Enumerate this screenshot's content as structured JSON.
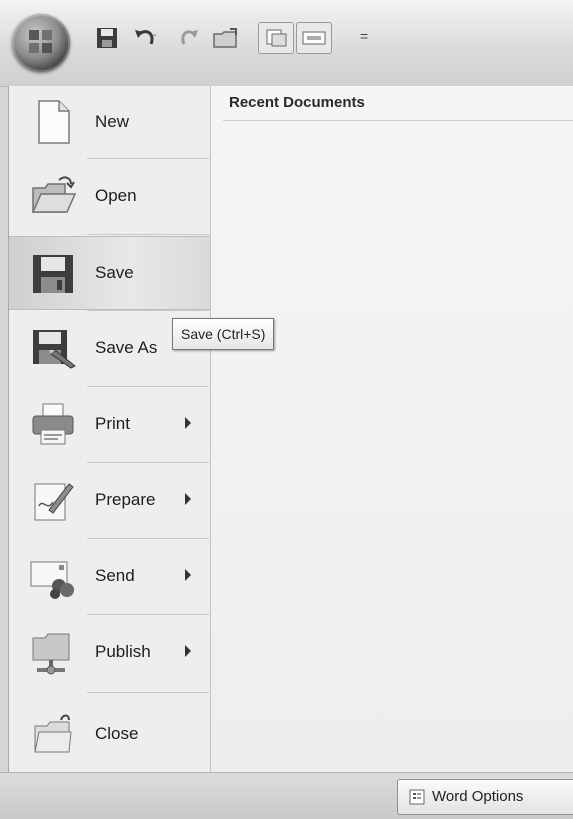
{
  "quick_access_toolbar": {
    "icons": [
      "office-button-icon",
      "save-icon",
      "undo-icon",
      "redo-icon",
      "folder-icon",
      "pages-icon",
      "envelope-icon",
      "customize-icon"
    ],
    "customize_glyph": "="
  },
  "menu": {
    "items": [
      {
        "label": "New",
        "icon": "new-document-icon"
      },
      {
        "label": "Open",
        "icon": "open-folder-icon"
      },
      {
        "label": "Save",
        "icon": "save-icon",
        "selected": true
      },
      {
        "label": "Save As",
        "icon": "save-as-icon"
      },
      {
        "label": "Print",
        "icon": "printer-icon",
        "submenu": true
      },
      {
        "label": "Prepare",
        "icon": "prepare-icon",
        "submenu": true
      },
      {
        "label": "Send",
        "icon": "send-icon",
        "submenu": true
      },
      {
        "label": "Publish",
        "icon": "publish-icon",
        "submenu": true
      },
      {
        "label": "Close",
        "icon": "close-folder-icon"
      }
    ]
  },
  "recent": {
    "title": "Recent Documents"
  },
  "tooltip": {
    "text": "Save (Ctrl+S)"
  },
  "bottom": {
    "word_options_label": "Word Options"
  }
}
